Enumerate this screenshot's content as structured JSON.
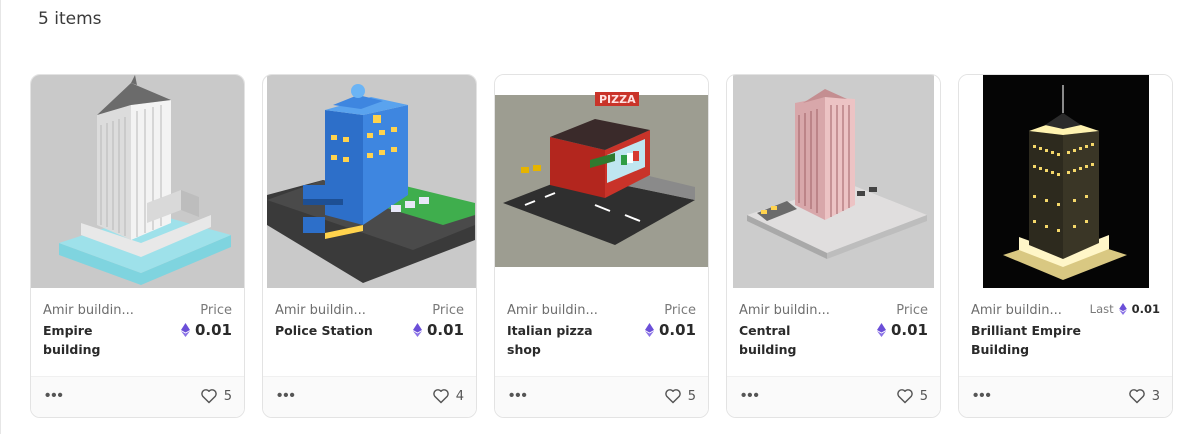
{
  "header": {
    "item_count": "5 items"
  },
  "items": [
    {
      "collection": "Amir buildin...",
      "name": "Empire building",
      "price_label": "Price",
      "price": "0.01",
      "likes": "5"
    },
    {
      "collection": "Amir buildin...",
      "name": "Police Station",
      "price_label": "Price",
      "price": "0.01",
      "likes": "4"
    },
    {
      "collection": "Amir buildin...",
      "name": "Italian pizza shop",
      "price_label": "Price",
      "price": "0.01",
      "likes": "5"
    },
    {
      "collection": "Amir buildin...",
      "name": "Central building",
      "price_label": "Price",
      "price": "0.01",
      "likes": "5"
    },
    {
      "collection": "Amir buildin...",
      "name": "Brilliant Empire Building",
      "price_label": "Last",
      "price": "0.01",
      "likes": "3"
    }
  ],
  "icons": {
    "currency": "ethereum-icon",
    "like": "heart-icon",
    "more": "more-options-icon"
  },
  "colors": {
    "eth": "#6b4fd8",
    "border": "#e3e3e3",
    "text": "#2a2a2a"
  }
}
